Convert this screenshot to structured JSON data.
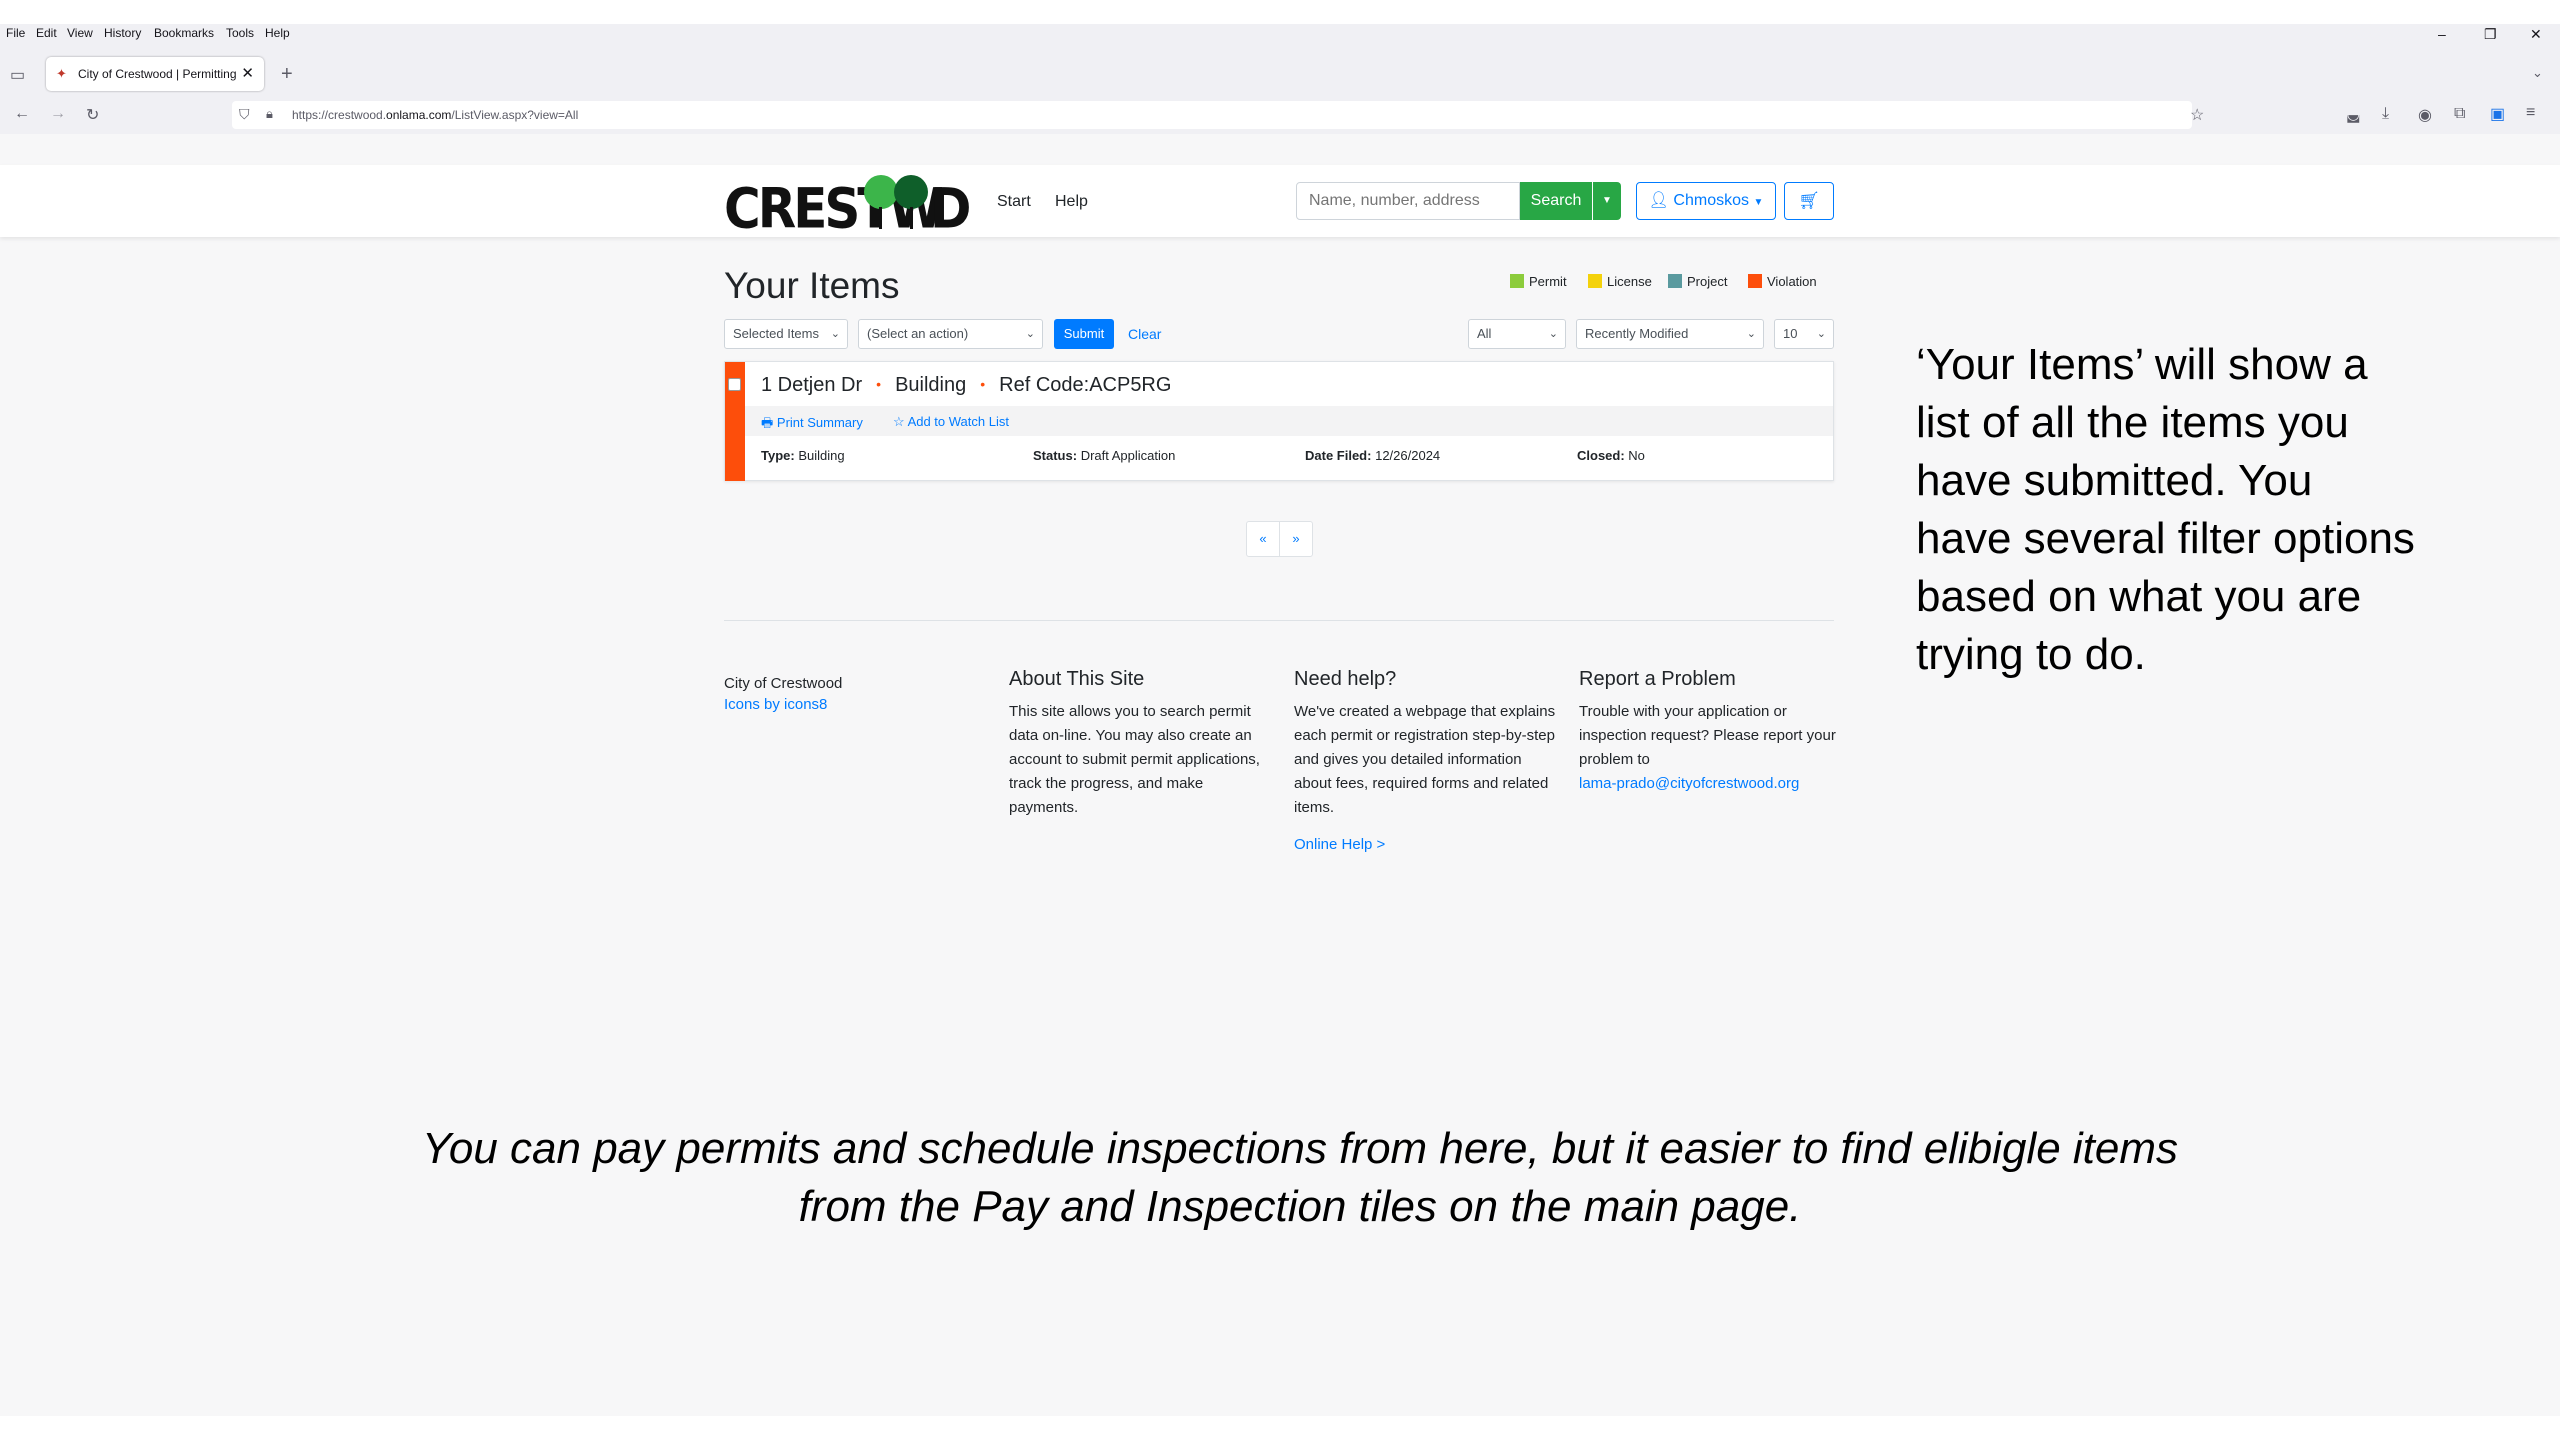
{
  "browser": {
    "menu": [
      "File",
      "Edit",
      "View",
      "History",
      "Bookmarks",
      "Tools",
      "Help"
    ],
    "tab_title": "City of Crestwood | Permitting",
    "url_prefix": "https://crestwood.",
    "url_domain": "onlama.com",
    "url_path": "/ListView.aspx?view=All"
  },
  "header": {
    "logo_left": "CRESTW",
    "logo_right": "D",
    "nav": [
      "Start",
      "Help"
    ],
    "search_placeholder": "Name, number, address",
    "search_button": "Search",
    "user_button": "Chmoskos"
  },
  "main": {
    "title": "Your Items",
    "legend": [
      {
        "label": "Permit",
        "color": "#8ccc3c"
      },
      {
        "label": "License",
        "color": "#f4d20c"
      },
      {
        "label": "Project",
        "color": "#5a9a9f"
      },
      {
        "label": "Violation",
        "color": "#fd4e0b"
      }
    ],
    "selected_items": "Selected Items",
    "action_select": "(Select an action)",
    "submit": "Submit",
    "clear": "Clear",
    "filter_all": "All",
    "sort": "Recently Modified",
    "page_size": "10",
    "item": {
      "address": "1 Detjen Dr",
      "category": "Building",
      "ref_code": "Ref Code:ACP5RG",
      "print_summary": "Print Summary",
      "watch_list": "Add to Watch List",
      "type_label": "Type:",
      "type_value": "Building",
      "status_label": "Status:",
      "status_value": "Draft Application",
      "date_label": "Date Filed:",
      "date_value": "12/26/2024",
      "closed_label": "Closed:",
      "closed_value": "No"
    },
    "pager": [
      "«",
      "»"
    ]
  },
  "footer": {
    "org": "City of Crestwood",
    "icons_credit": "Icons by icons8",
    "about_title": "About This Site",
    "about_text": "This site allows you to search permit data on-line. You may also create an account to submit permit applications, track the progress, and make payments.",
    "help_title": "Need help?",
    "help_text": "We've created a webpage that explains each permit or registration step-by-step and gives you detailed information about fees, required forms and related items.",
    "help_link": "Online Help >",
    "report_title": "Report a Problem",
    "report_text": "Trouble with your application or inspection request? Please report your problem to",
    "report_email": "lama-prado@cityofcrestwood.org"
  },
  "annotations": {
    "right": "‘Your Items’ will show a list of all the items you have submitted.  You have several filter options based on what you are trying to do.",
    "bottom": "You can pay permits and schedule inspections from here, but it easier to find elibigle items from the Pay and Inspection tiles on the main page."
  }
}
